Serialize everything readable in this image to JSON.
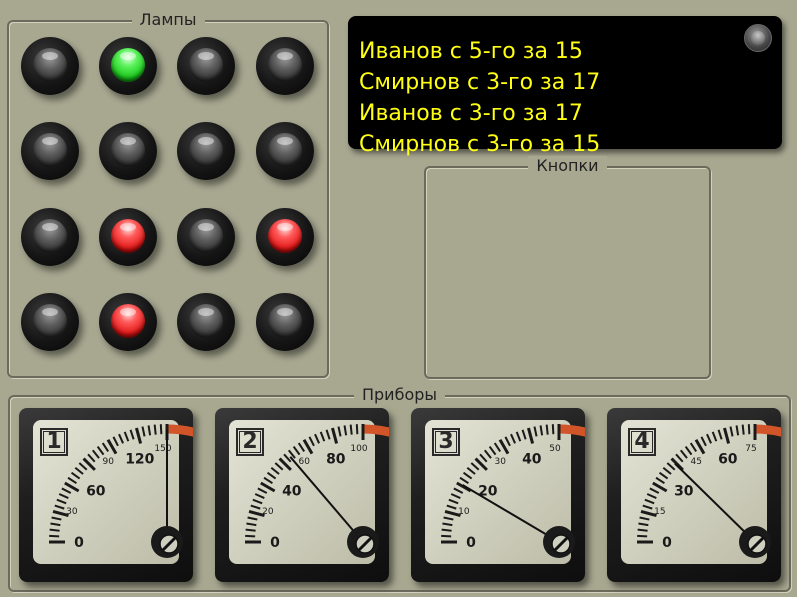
{
  "lamps_group": {
    "title": "Лампы",
    "lamps": [
      [
        "off",
        "green",
        "off",
        "off"
      ],
      [
        "off",
        "off",
        "off",
        "off"
      ],
      [
        "off",
        "red",
        "off",
        "red"
      ],
      [
        "off",
        "red",
        "off",
        "off"
      ]
    ]
  },
  "messages": {
    "lines": [
      "Иванов с 5-го за 15",
      "Смирнов с 3-го за 17",
      "Иванов с 3-го за 17",
      "Смирнов с 3-го за 15"
    ],
    "text_color": "#ffff14"
  },
  "buttons_group": {
    "title": "Кнопки"
  },
  "instruments_group": {
    "title": "Приборы",
    "gauges": [
      {
        "number": "1",
        "max": 150,
        "major": [
          "0",
          "60",
          "120"
        ],
        "minor": [
          "30",
          "90",
          "150"
        ],
        "value": 150
      },
      {
        "number": "2",
        "max": 100,
        "major": [
          "0",
          "40",
          "80"
        ],
        "minor": [
          "20",
          "60",
          "100"
        ],
        "value": 55
      },
      {
        "number": "3",
        "max": 50,
        "major": [
          "0",
          "20",
          "40"
        ],
        "minor": [
          "10",
          "30",
          "50"
        ],
        "value": 17
      },
      {
        "number": "4",
        "max": 75,
        "major": [
          "0",
          "30",
          "60"
        ],
        "minor": [
          "15",
          "45",
          "75"
        ],
        "value": 37
      }
    ]
  },
  "colors": {
    "background": "#a8a891",
    "lamp_green": "#19c419",
    "lamp_red": "#e01414",
    "gauge_face": "#c4c4b0",
    "gauge_red_zone": "#d2552a"
  }
}
